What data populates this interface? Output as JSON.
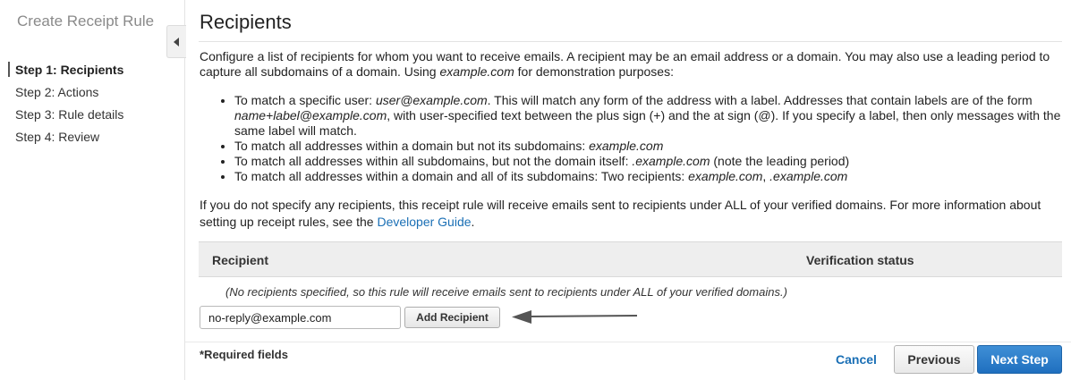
{
  "sidebar": {
    "title": "Create Receipt Rule",
    "steps": [
      {
        "label": "Step 1: Recipients",
        "active": true
      },
      {
        "label": "Step 2: Actions",
        "active": false
      },
      {
        "label": "Step 3: Rule details",
        "active": false
      },
      {
        "label": "Step 4: Review",
        "active": false
      }
    ],
    "collapse_icon": "chevron-left-icon"
  },
  "main": {
    "title": "Recipients",
    "intro": {
      "text1": "Configure a list of recipients for whom you want to receive emails. A recipient may be an email address or a domain. You may also use a leading period to capture all subdomains of a domain. Using ",
      "example": "example.com",
      "text2": " for demonstration purposes:"
    },
    "bullets": {
      "b1": {
        "t1": "To match a specific user: ",
        "e1": "user@example.com",
        "t2": ". This will match any form of the address with a label. Addresses that contain labels are of the form ",
        "e2": "name+label@example.com",
        "t3": ", with user-specified text between the plus sign (+) and the at sign (@). If you specify a label, then only messages with the same label will match."
      },
      "b2": {
        "t1": "To match all addresses within a domain but not its subdomains: ",
        "e1": "example.com"
      },
      "b3": {
        "t1": "To match all addresses within all subdomains, but not the domain itself: ",
        "e1": ".example.com",
        "t2": " (note the leading period)"
      },
      "b4": {
        "t1": "To match all addresses within a domain and all of its subdomains: Two recipients: ",
        "e1": "example.com",
        "t2": ", ",
        "e2": ".example.com"
      }
    },
    "outro": {
      "text": "If you do not specify any recipients, this receipt rule will receive emails sent to recipients under ALL of your verified domains. For more information about setting up receipt rules, see the ",
      "link": "Developer Guide",
      "end": "."
    },
    "table": {
      "headers": [
        "Recipient",
        "Verification status"
      ],
      "empty_note": "(No recipients specified, so this rule will receive emails sent to recipients under ALL of your verified domains.)"
    },
    "recipient_input": {
      "value": "no-reply@example.com"
    },
    "add_button": "Add Recipient",
    "arrow_icon": "arrow-left-icon"
  },
  "footer": {
    "required": "*Required fields",
    "cancel": "Cancel",
    "previous": "Previous",
    "next": "Next Step"
  },
  "colors": {
    "link": "#1a6fb5",
    "primary_button": "#1f6fbf",
    "table_header_bg": "#eeeeee"
  }
}
